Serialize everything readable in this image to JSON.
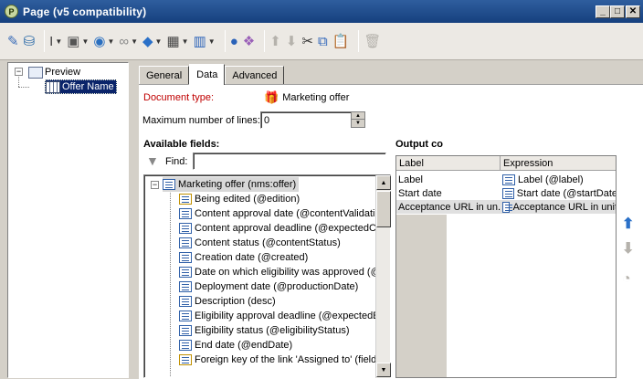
{
  "window": {
    "title": "Page (v5 compatibility)",
    "app_icon_letter": "P"
  },
  "toolbar": {
    "icons": [
      "magic-wand-icon",
      "database-icon",
      "text-cursor-icon",
      "form-icon",
      "globe-icon",
      "link-icon",
      "layers-icon",
      "table-icon",
      "columns-icon",
      "person-icon",
      "shapes-icon",
      "move-up-icon",
      "move-down-icon",
      "cut-icon",
      "copy-icon",
      "paste-icon",
      "delete-icon"
    ]
  },
  "tree": {
    "root_label": "Preview",
    "child_label": "Offer Name"
  },
  "tabs": [
    {
      "label": "General",
      "active": false
    },
    {
      "label": "Data",
      "active": true
    },
    {
      "label": "Advanced",
      "active": false
    }
  ],
  "data_tab": {
    "document_type_label": "Document type:",
    "document_type_value": "Marketing offer",
    "max_lines_label": "Maximum number of lines:",
    "max_lines_value": "0",
    "available_fields_label": "Available fields:",
    "find_label": "Find:",
    "find_value": "",
    "output_label": "Output co"
  },
  "available_fields": {
    "root": "Marketing offer (nms:offer)",
    "items": [
      "Being edited (@edition)",
      "Content approval date (@contentValidati",
      "Content approval deadline (@expectedC",
      "Content status (@contentStatus)",
      "Creation date (@created)",
      "Date on which eligibility was approved (@",
      "Deployment date (@productionDate)",
      "Description (desc)",
      "Eligibility approval deadline (@expectedE",
      "Eligibility status (@eligibilityStatus)",
      "End date (@endDate)",
      "Foreign key of the link 'Assigned to' (field"
    ]
  },
  "output_grid": {
    "headers": [
      "Label",
      "Expression"
    ],
    "rows": [
      [
        "Label",
        "Label (@label)"
      ],
      [
        "Start date",
        "Start date (@startDate"
      ],
      [
        "Acceptance URL in un...",
        "Acceptance URL in unit"
      ]
    ]
  },
  "colors": {
    "titlebar": "#1e4a8a",
    "required_label": "#c00000",
    "accent_blue": "#3a6cb8"
  }
}
